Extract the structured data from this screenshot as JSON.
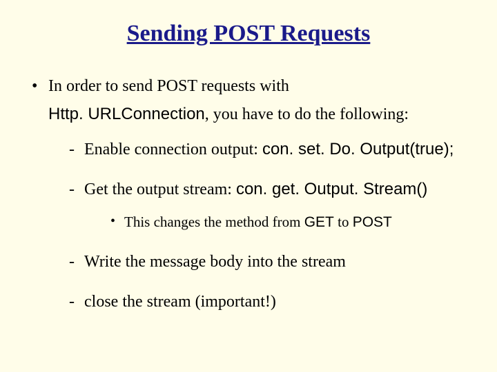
{
  "title": "Sending POST Requests",
  "l1": {
    "part1": "In order to send POST requests with ",
    "code1": "Http. URLConnection",
    "part2": ", you have to do the following:"
  },
  "l2": {
    "i0": {
      "text": "Enable connection output: ",
      "code": "con. set. Do. Output(true);"
    },
    "i1": {
      "text": "Get the output stream: ",
      "code": "con. get. Output. Stream()"
    },
    "i2": {
      "text": "Write the message body into the stream"
    },
    "i3": {
      "text": "close the stream (important!)"
    }
  },
  "l3": {
    "i0": {
      "pre": "This changes the method from ",
      "c1": "GET",
      "mid": " to ",
      "c2": "POST"
    }
  }
}
